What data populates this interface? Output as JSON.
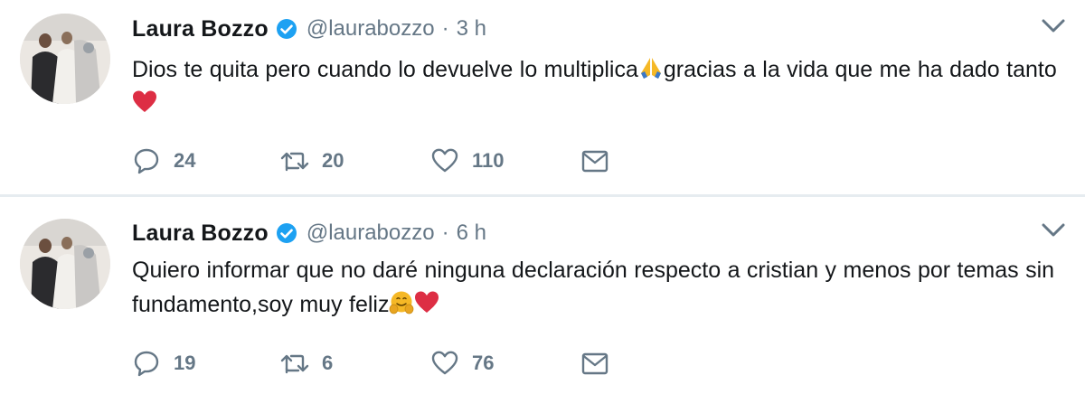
{
  "tweets": [
    {
      "name": "Laura Bozzo",
      "handle": "@laurabozzo",
      "separator": "·",
      "time": "3 h",
      "text_part1": "Dios te quita pero cuando lo devuelve lo multiplica",
      "text_part2": "gracias a la vida que me ha dado tanto ",
      "emojis": [
        "folded-hands-icon",
        "red-heart-icon"
      ],
      "replies": "24",
      "retweets": "20",
      "likes": "110"
    },
    {
      "name": "Laura Bozzo",
      "handle": "@laurabozzo",
      "separator": "·",
      "time": "6 h",
      "text_part1": "Quiero informar que no daré ninguna declaración respecto  a cristian y menos por temas sin fundamento,soy muy feliz",
      "text_part2": "",
      "emojis": [
        "hugging-face-icon",
        "red-heart-icon"
      ],
      "replies": "19",
      "retweets": "6",
      "likes": "76"
    }
  ],
  "colors": {
    "text": "#14171a",
    "secondary": "#657786",
    "verified": "#1da1f2",
    "heart": "#e0245e",
    "divider": "#e6ecf0"
  }
}
